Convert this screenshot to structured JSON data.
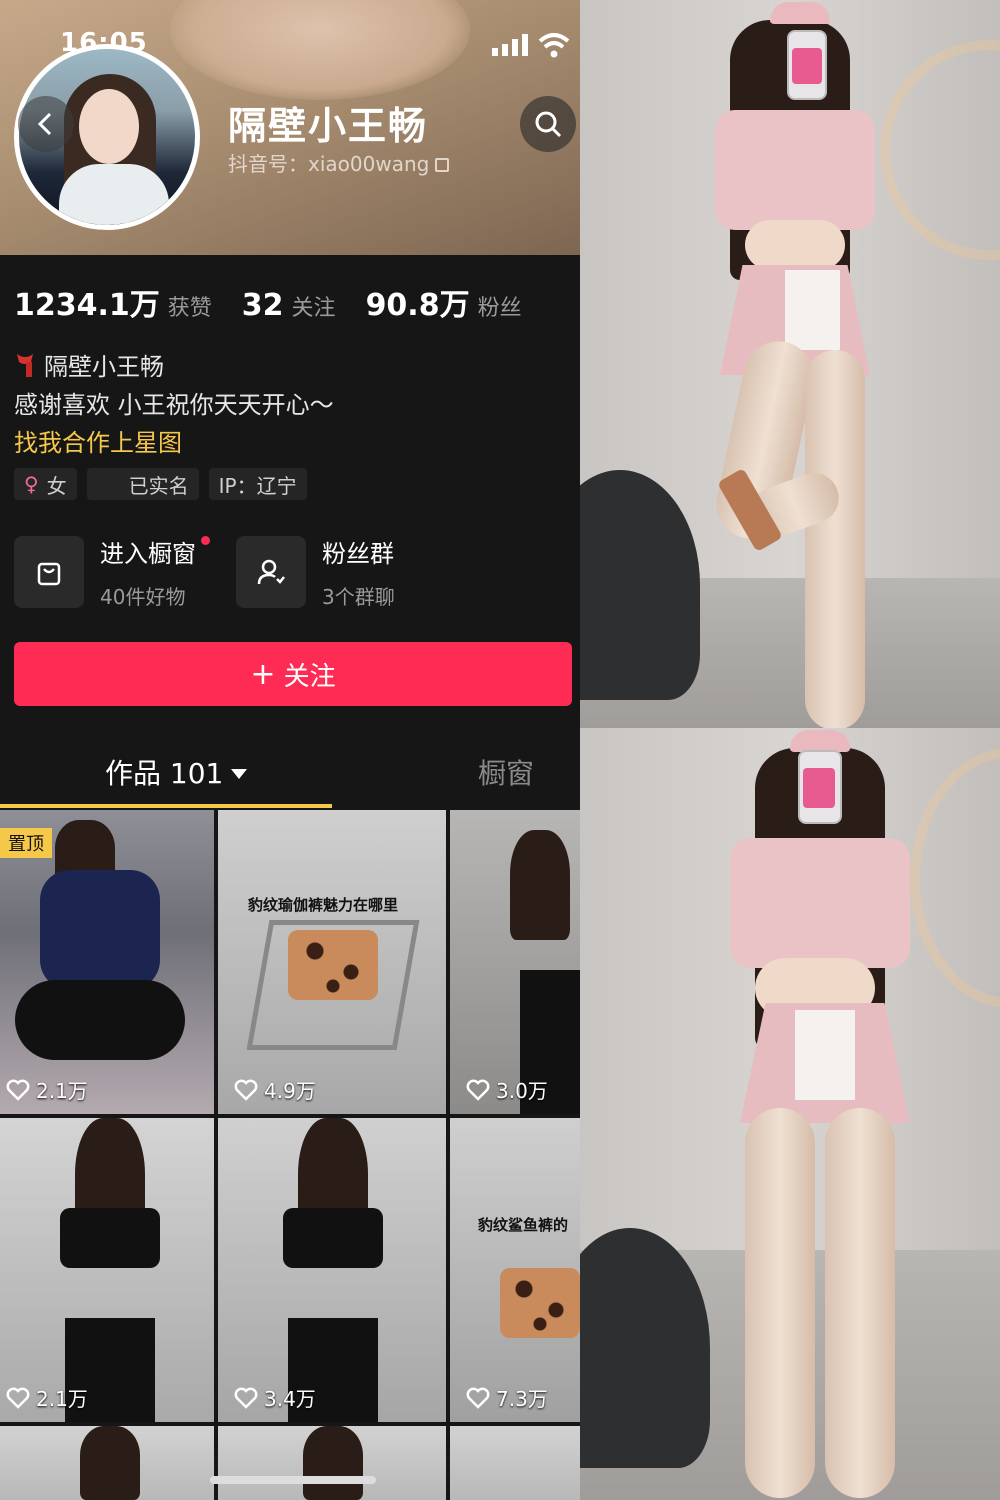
{
  "status_bar": {
    "time": "16:05"
  },
  "profile": {
    "name": "隔壁小王畅",
    "douyin_id": "抖音号：xiao00wang"
  },
  "stats": [
    {
      "value": "1234.1万",
      "label": "获赞"
    },
    {
      "value": "32",
      "label": "关注"
    },
    {
      "value": "90.8万",
      "label": "粉丝"
    }
  ],
  "bio": {
    "line1": "隔壁小王畅",
    "line2": "感谢喜欢 小王祝你天天开心～",
    "link": "找我合作上星图"
  },
  "tags": [
    {
      "text": "女",
      "icon": "female-icon"
    },
    {
      "text": "已实名",
      "icon": "verified-icon"
    },
    {
      "text": "IP：辽宁",
      "icon": ""
    }
  ],
  "cards": [
    {
      "title": "进入橱窗",
      "sub": "40件好物",
      "icon": "shopping-bag-icon",
      "has_dot": true
    },
    {
      "title": "粉丝群",
      "sub": "3个群聊",
      "icon": "group-chat-icon",
      "has_dot": false
    }
  ],
  "follow_button": {
    "plus": "+",
    "label": "关注"
  },
  "tabs": {
    "works": "作品 101",
    "shop": "橱窗"
  },
  "grid": {
    "pin_label": "置顶",
    "tiles": [
      {
        "likes": "2.1万",
        "caption": ""
      },
      {
        "likes": "4.9万",
        "caption": "豹纹瑜伽裤魅力在哪里"
      },
      {
        "likes": "3.0万",
        "caption": ""
      },
      {
        "likes": "2.1万",
        "caption": ""
      },
      {
        "likes": "3.4万",
        "caption": ""
      },
      {
        "likes": "7.3万",
        "caption": "豹纹鲨鱼裤的"
      }
    ]
  },
  "colors": {
    "accent": "#fe2c55",
    "highlight": "#f6c84a",
    "background": "#161616"
  }
}
